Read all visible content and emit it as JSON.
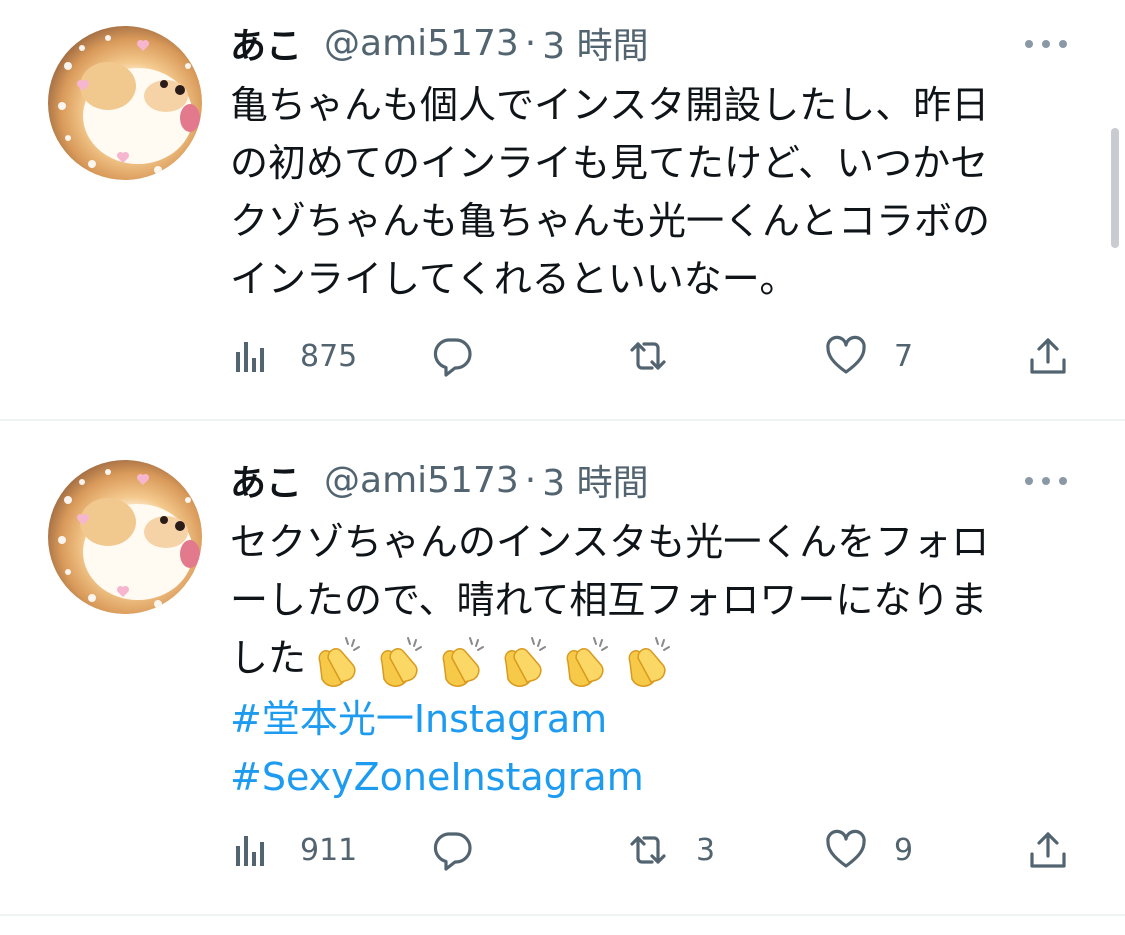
{
  "tweets": [
    {
      "name": "あこ",
      "handle": "@ami5173",
      "separator": "·",
      "time": "3 時間",
      "text_lines": [
        "亀ちゃんも個人でインスタ開設したし、昨日",
        "の初めてのインライも見てたけど、いつかセ",
        "クゾちゃんも亀ちゃんも光一くんとコラボの",
        "インライしてくれるといいなー。"
      ],
      "hashtags": [],
      "views": "875",
      "replies": "",
      "retweets": "",
      "likes": "7"
    },
    {
      "name": "あこ",
      "handle": "@ami5173",
      "separator": "·",
      "time": "3 時間",
      "text_lines": [
        "セクゾちゃんのインスタも光一くんをフォロ",
        "ーしたので、晴れて相互フォロワーになりま",
        "した"
      ],
      "emoji": "clapping-hands x6",
      "hashtags": [
        "#堂本光一Instagram",
        "#SexyZoneInstagram"
      ],
      "views": "911",
      "replies": "",
      "retweets": "3",
      "likes": "9"
    }
  ],
  "icons": {
    "views": "bar-chart-icon",
    "reply": "speech-bubble-icon",
    "retweet": "retweet-arrows-icon",
    "like": "heart-icon",
    "share": "share-upload-icon",
    "more": "more-dots-icon"
  },
  "colors": {
    "text": "#0f1419",
    "secondary": "#536471",
    "hashtag": "#1d9bf0",
    "divider": "#eff3f4"
  }
}
